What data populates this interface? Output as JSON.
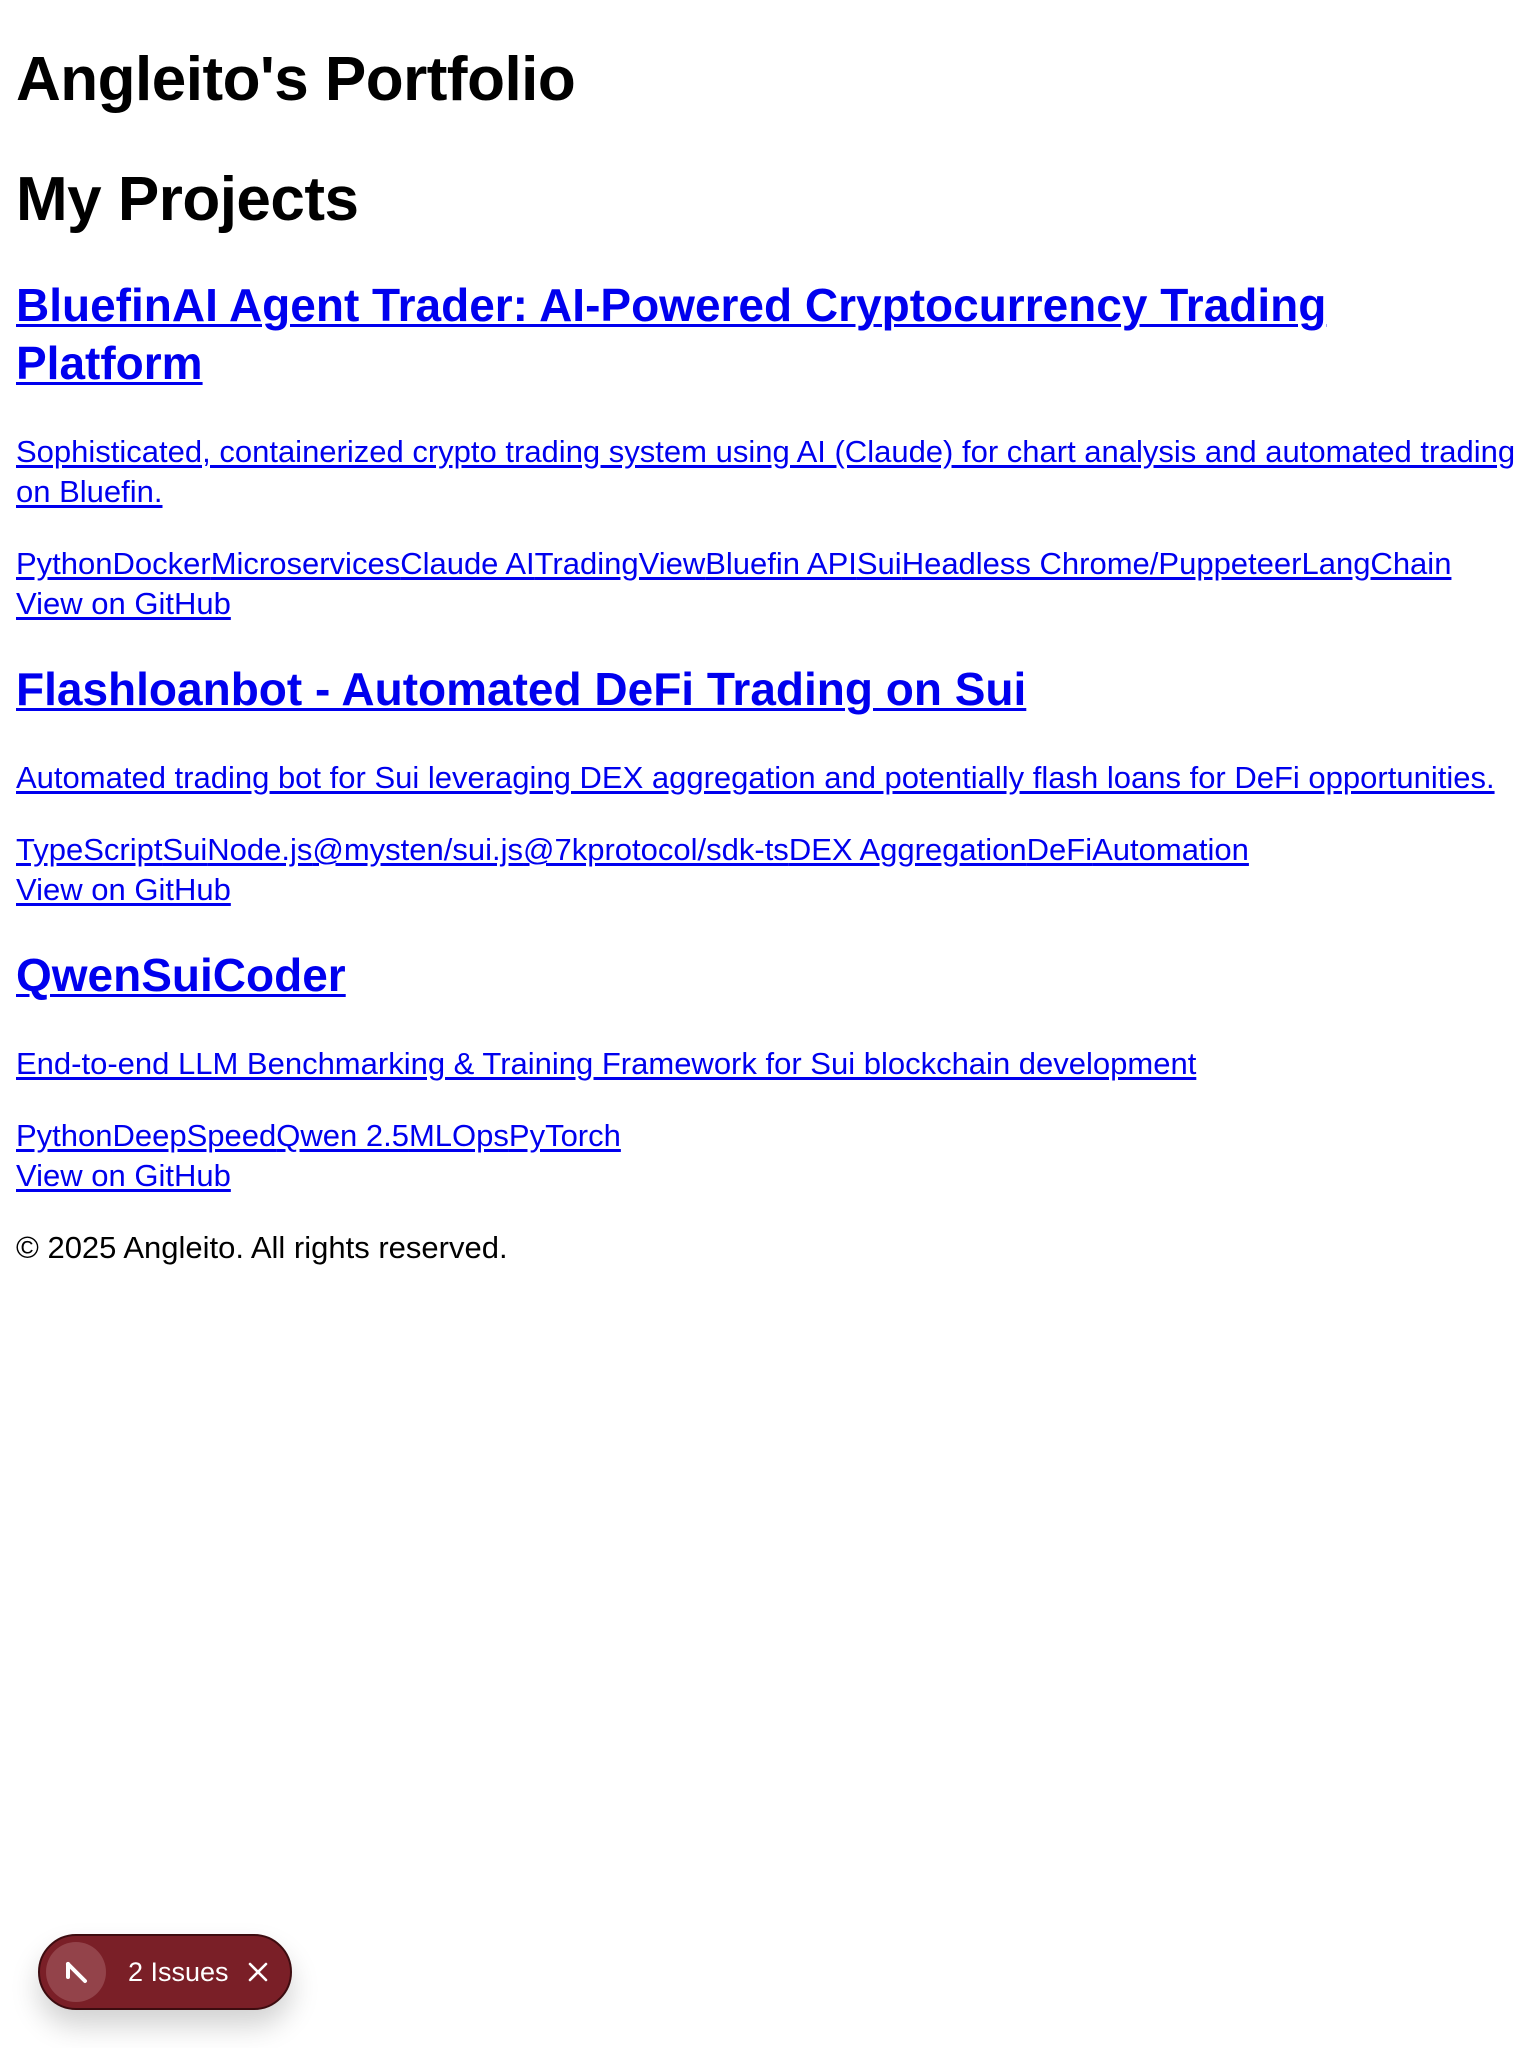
{
  "header": {
    "site_title": "Angleito's Portfolio"
  },
  "projects_section": {
    "title": "My Projects",
    "projects": [
      {
        "title": "BluefinAI Agent Trader: AI-Powered Cryptocurrency Trading Platform",
        "description": "Sophisticated, containerized crypto trading system using AI (Claude) for chart analysis and automated trading on Bluefin.",
        "technologies": [
          "Python",
          "Docker",
          "Microservices",
          "Claude AI",
          "TradingView",
          "Bluefin API",
          "Sui",
          "Headless Chrome/Puppeteer",
          "LangChain"
        ],
        "link_label": "View on GitHub"
      },
      {
        "title": "Flashloanbot - Automated DeFi Trading on Sui",
        "description": "Automated trading bot for Sui leveraging DEX aggregation and potentially flash loans for DeFi opportunities.",
        "technologies": [
          "TypeScript",
          "Sui",
          "Node.js",
          "@mysten/sui.js",
          "@7kprotocol/sdk-ts",
          "DEX Aggregation",
          "DeFi",
          "Automation"
        ],
        "link_label": "View on GitHub"
      },
      {
        "title": "QwenSuiCoder",
        "description": "End-to-end LLM Benchmarking & Training Framework for Sui blockchain development",
        "technologies": [
          "Python",
          "DeepSpeed",
          "Qwen 2.5",
          "MLOps",
          "PyTorch"
        ],
        "link_label": "View on GitHub"
      }
    ]
  },
  "footer": {
    "copyright": "© 2025 Angleito. All rights reserved."
  },
  "issues_badge": {
    "label": "2 Issues",
    "icon": "nextjs-logo-icon",
    "close_icon": "close-icon",
    "colors": {
      "background": "#7a1f27",
      "icon_background": "#93434a",
      "text": "#ffffff"
    }
  },
  "colors": {
    "link": "#0000ee",
    "text": "#000000",
    "background": "#ffffff"
  }
}
